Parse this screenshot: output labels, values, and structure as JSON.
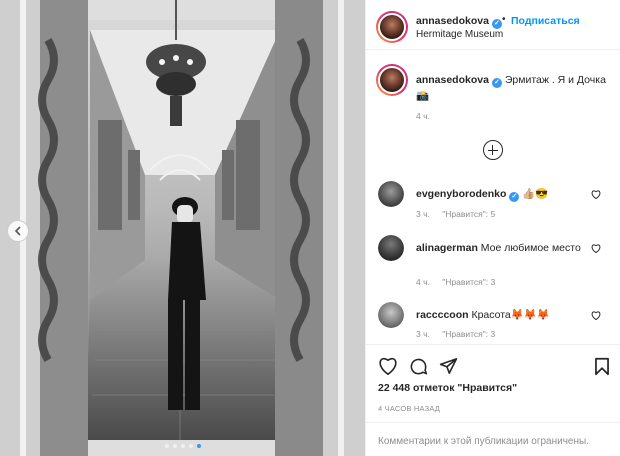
{
  "post": {
    "author": "annasedokova",
    "follow_label": "Подписаться",
    "separator": "•",
    "location": "Hermitage Museum",
    "caption_text": "Эрмитаж . Я и Дочка 📸",
    "caption_time": "4 ч.",
    "verified_mark": "✓"
  },
  "comments": [
    {
      "user": "evgenyborodenko",
      "verified": true,
      "text": "👍🏼😎",
      "time": "3 ч.",
      "likes": "\"Нравится\": 5"
    },
    {
      "user": "alinagerman",
      "verified": false,
      "text": "Мое любимое место",
      "time": "4 ч.",
      "likes": "\"Нравится\": 3"
    },
    {
      "user": "raccccoon",
      "verified": false,
      "text": "Красота🦊🦊🦊",
      "time": "3 ч.",
      "likes": "\"Нравится\": 3"
    }
  ],
  "actions": {
    "likes_count": "22 448 отметок \"Нравится\"",
    "posted_time": "4 ЧАСОВ НАЗАД",
    "comments_disabled": "Комментарии к этой публикации ограничены."
  },
  "carousel": {
    "slide_count": 5,
    "active_index": 4
  },
  "icons": {
    "heart": "heart-icon",
    "comment": "comment-bubble-icon",
    "share": "paper-plane-icon",
    "save": "bookmark-icon",
    "load_more": "plus-circle-icon",
    "prev": "chevron-left-icon"
  },
  "colors": {
    "link": "#0095f6",
    "verified": "#3897f0",
    "muted": "#8e8e8e",
    "text": "#262626"
  }
}
